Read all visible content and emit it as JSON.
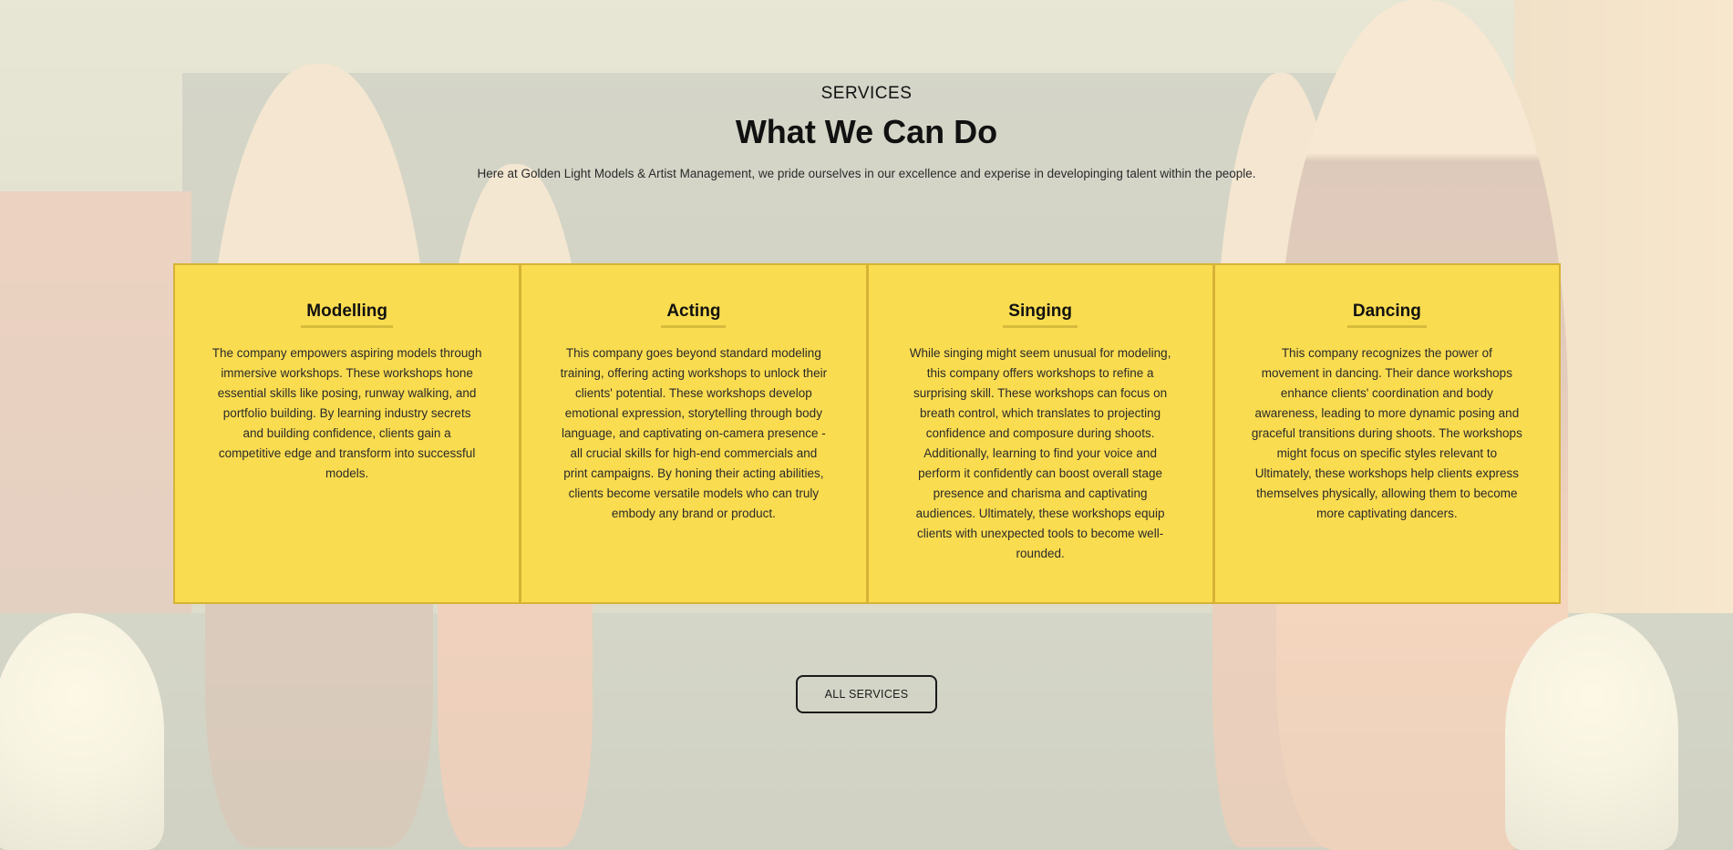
{
  "section": {
    "eyebrow": "SERVICES",
    "title": "What We Can Do",
    "subtitle": "Here at Golden Light Models & Artist Management, we pride ourselves in our excellence and experise in developinging talent within the people."
  },
  "services": [
    {
      "title": "Modelling",
      "description": "The company empowers aspiring models through immersive workshops. These workshops hone essential skills like posing, runway walking, and portfolio building. By learning industry secrets and building confidence, clients gain a competitive edge and transform into successful models."
    },
    {
      "title": "Acting",
      "description": "This company goes beyond standard modeling training, offering acting workshops to unlock their clients' potential. These workshops develop emotional expression, storytelling through body language, and captivating on-camera presence - all crucial skills for high-end commercials and print campaigns. By honing their acting abilities, clients become versatile models who can truly embody any brand or product."
    },
    {
      "title": "Singing",
      "description": "While singing might seem unusual for modeling, this company offers workshops to refine a surprising skill. These workshops can focus on breath control, which translates to projecting confidence and composure during shoots. Additionally, learning to find your voice and perform it confidently can boost overall stage presence and charisma and captivating audiences. Ultimately, these workshops equip clients with unexpected tools to become well-rounded."
    },
    {
      "title": "Dancing",
      "description": "This company recognizes the power of movement in dancing. Their dance workshops enhance clients' coordination and body awareness, leading to more dynamic posing and graceful transitions during shoots. The workshops might focus on specific styles relevant to Ultimately, these workshops help clients express themselves physically, allowing them to become more captivating dancers."
    }
  ],
  "cta": {
    "label": "ALL SERVICES"
  },
  "colors": {
    "card_background": "#fadc50",
    "card_border": "#d6b336",
    "overlay": "#fff9e4"
  }
}
